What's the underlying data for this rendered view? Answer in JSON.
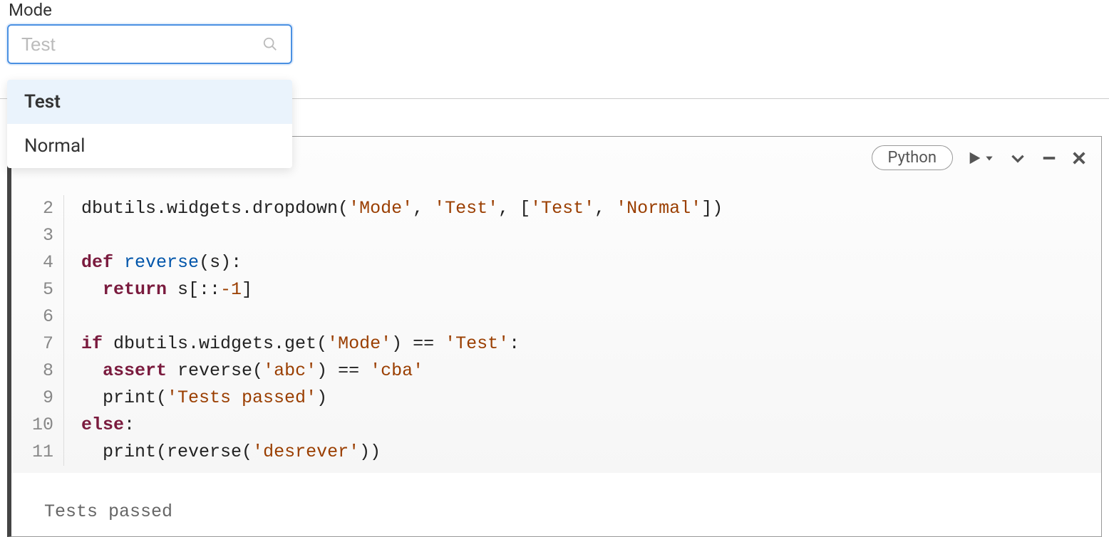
{
  "widget": {
    "label": "Mode",
    "placeholder": "Test",
    "options": [
      "Test",
      "Normal"
    ],
    "selected": "Test"
  },
  "cell": {
    "language": "Python",
    "gutter": [
      "2",
      "3",
      "4",
      "5",
      "6",
      "7",
      "8",
      "9",
      "10",
      "11"
    ],
    "code": {
      "l2": {
        "t1": "dbutils.widgets.dropdown(",
        "s1": "'Mode'",
        "t2": ", ",
        "s2": "'Test'",
        "t3": ", [",
        "s3": "'Test'",
        "t4": ", ",
        "s4": "'Normal'",
        "t5": "])"
      },
      "l3": "",
      "l4": {
        "kw": "def",
        "sp": " ",
        "fn": "reverse",
        "rest": "(s):"
      },
      "l5": {
        "indent": "  ",
        "kw": "return",
        "rest1": " s[::",
        "num": "-1",
        "rest2": "]"
      },
      "l6": "",
      "l7": {
        "kw": "if",
        "t1": " dbutils.widgets.get(",
        "s1": "'Mode'",
        "t2": ") == ",
        "s2": "'Test'",
        "t3": ":"
      },
      "l8": {
        "indent": "  ",
        "kw": "assert",
        "t1": " reverse(",
        "s1": "'abc'",
        "t2": ") == ",
        "s2": "'cba'"
      },
      "l9": {
        "indent": "  ",
        "t1": "print(",
        "s1": "'Tests passed'",
        "t2": ")"
      },
      "l10": {
        "kw": "else",
        "t1": ":"
      },
      "l11": {
        "indent": "  ",
        "t1": "print(reverse(",
        "s1": "'desrever'",
        "t2": "))"
      }
    },
    "output": "Tests passed"
  }
}
